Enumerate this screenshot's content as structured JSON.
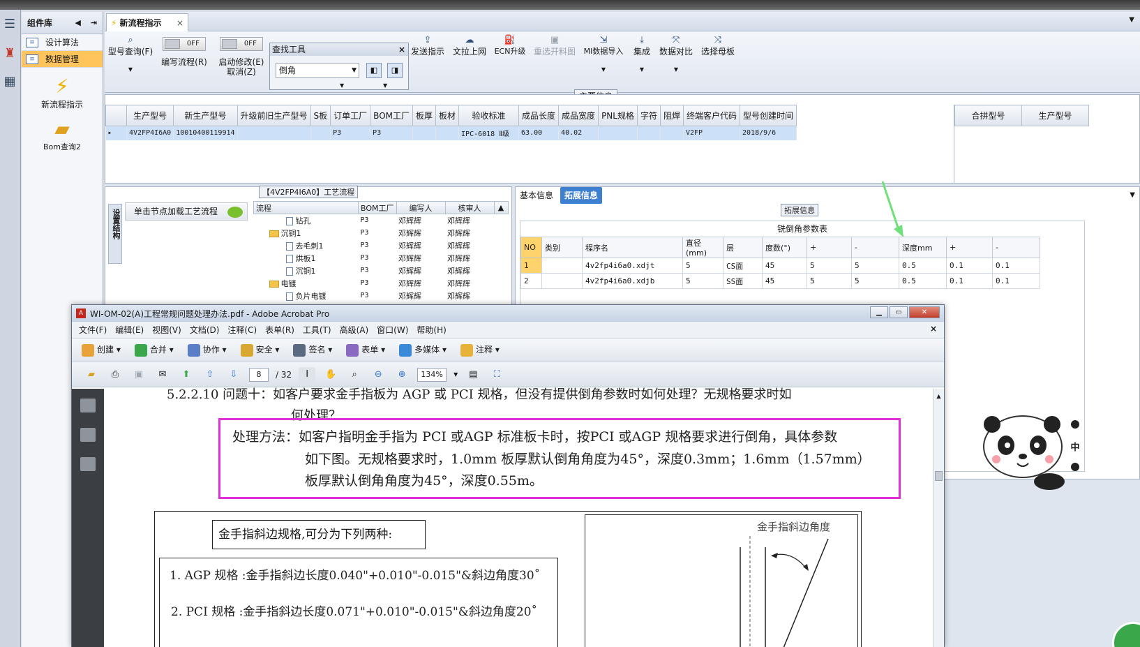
{
  "left_sidebar": {
    "header": "组件库",
    "items": [
      {
        "label": "设计算法",
        "active": false
      },
      {
        "label": "数据管理",
        "active": true
      }
    ],
    "big_items": [
      {
        "label": "新流程指示",
        "icon": "lightning-icon"
      },
      {
        "label": "Bom查询2",
        "icon": "folder-open-icon"
      }
    ]
  },
  "tab": {
    "title": "新流程指示",
    "close": "×"
  },
  "ribbon": {
    "query_label": "型号查询(F)",
    "edit_flow_label": "编写流程(R)",
    "auto_edit_label": "启动修改(E)",
    "cancel_label": "取消(Z)",
    "toggle_off": "OFF",
    "find_tool": {
      "title": "查找工具",
      "value": "倒角",
      "close": "×"
    },
    "buttons": [
      {
        "label": "发送指示",
        "icon": "upload-icon"
      },
      {
        "label": "文拉上网",
        "icon": "cloud-upload-icon"
      },
      {
        "label": "ECN升级",
        "icon": "ecn-icon"
      },
      {
        "label": "重选开料图",
        "icon": "image-icon",
        "disabled": true
      },
      {
        "label": "MI数据导入",
        "icon": "import-icon"
      },
      {
        "label": "集成",
        "icon": "download-icon"
      },
      {
        "label": "数据对比",
        "icon": "compare-icon"
      },
      {
        "label": "选择母板",
        "icon": "shuffle-icon"
      }
    ]
  },
  "main_info": {
    "title": "主要信息",
    "columns": [
      "生产型号",
      "新生产型号",
      "升级前旧生产型号",
      "S板",
      "订单工厂",
      "BOM工厂",
      "板厚",
      "板材",
      "验收标准",
      "成品长度",
      "成品宽度",
      "PNL规格",
      "字符",
      "阻焊",
      "终端客户代码",
      "型号创建时间"
    ],
    "row": [
      "4V2FP4I6A0",
      "10010400119914",
      "",
      "",
      "P3",
      "P3",
      "",
      "",
      "IPC-6018 Ⅱ级",
      "63.00",
      "40.02",
      "",
      "",
      "",
      "V2FP",
      "2018/9/6"
    ],
    "side_columns": [
      "合拼型号",
      "生产型号"
    ]
  },
  "process": {
    "title": "【4V2FP4I6A0】工艺流程",
    "vertical_tab": "设置结构",
    "hint": "单击节点加载工艺流程",
    "columns": [
      "流程",
      "BOM工厂",
      "编写人",
      "核审人"
    ],
    "rows": [
      {
        "name": "钻孔",
        "type": "doc",
        "indent": 2,
        "bom": "P3",
        "writer": "邓辉辉",
        "reviewer": "邓辉辉"
      },
      {
        "name": "沉铜1",
        "type": "folder",
        "indent": 1,
        "bom": "P3",
        "writer": "邓辉辉",
        "reviewer": "邓辉辉"
      },
      {
        "name": "去毛刺1",
        "type": "doc",
        "indent": 2,
        "bom": "P3",
        "writer": "邓辉辉",
        "reviewer": "邓辉辉"
      },
      {
        "name": "烘板1",
        "type": "doc",
        "indent": 2,
        "bom": "P3",
        "writer": "邓辉辉",
        "reviewer": "邓辉辉"
      },
      {
        "name": "沉铜1",
        "type": "doc",
        "indent": 2,
        "bom": "P3",
        "writer": "邓辉辉",
        "reviewer": "邓辉辉"
      },
      {
        "name": "电镀",
        "type": "folder",
        "indent": 1,
        "bom": "P3",
        "writer": "邓辉辉",
        "reviewer": "邓辉辉"
      },
      {
        "name": "负片电镀",
        "type": "doc",
        "indent": 2,
        "bom": "P3",
        "writer": "邓辉辉",
        "reviewer": "邓辉辉"
      }
    ]
  },
  "ext_info": {
    "tabs": [
      {
        "label": "基本信息",
        "active": false
      },
      {
        "label": "拓展信息",
        "active": true
      }
    ],
    "title": "拓展信息",
    "table_title": "铣倒角参数表",
    "columns": [
      "NO",
      "类别",
      "程序名",
      "直径(mm)",
      "层",
      "度数(°)",
      "+",
      "-",
      "深度mm",
      "+",
      "-"
    ],
    "rows": [
      [
        "1",
        "",
        "4v2fp4i6a0.xdjt",
        "5",
        "CS面",
        "45",
        "5",
        "5",
        "0.5",
        "0.1",
        "0.1"
      ],
      [
        "2",
        "",
        "4v2fp4i6a0.xdjb",
        "5",
        "SS面",
        "45",
        "5",
        "5",
        "0.5",
        "0.1",
        "0.1"
      ]
    ]
  },
  "acrobat": {
    "title": "WI-OM-02(A)工程常规问题处理办法.pdf - Adobe Acrobat Pro",
    "menus": [
      "文件(F)",
      "编辑(E)",
      "视图(V)",
      "文档(D)",
      "注释(C)",
      "表单(R)",
      "工具(T)",
      "高级(A)",
      "窗口(W)",
      "帮助(H)"
    ],
    "toolbar1": [
      {
        "label": "创建",
        "icon": "gear-icon",
        "color": "#e8a23a"
      },
      {
        "label": "合并",
        "icon": "merge-icon",
        "color": "#3aa84a"
      },
      {
        "label": "协作",
        "icon": "collaborate-icon",
        "color": "#5a7ec8"
      },
      {
        "label": "安全",
        "icon": "lock-icon",
        "color": "#d8a832"
      },
      {
        "label": "签名",
        "icon": "pen-icon",
        "color": "#5a6a80"
      },
      {
        "label": "表单",
        "icon": "form-icon",
        "color": "#8a6ac0"
      },
      {
        "label": "多媒体",
        "icon": "media-icon",
        "color": "#3a8ad8"
      },
      {
        "label": "注释",
        "icon": "comment-icon",
        "color": "#e8b23a"
      }
    ],
    "page_current": "8",
    "page_total": "/ 32",
    "zoom": "134%",
    "doc": {
      "line1": "5.2.2.10 问题十：如客户要求金手指板为 AGP 或 PCI 规格，但没有提供倒角参数时如何处理？无规格要求时如",
      "line2": "何处理？",
      "method1": "处理方法：如客户指明金手指为 PCI 或AGP 标准板卡时，按PCI 或AGP 规格要求进行倒角，具体参数",
      "method2": "如下图。无规格要求时，1.0mm 板厚默认倒角角度为45°，深度0.3mm；1.6mm（1.57mm）",
      "method3": "板厚默认倒角角度为45°，深度0.55m。",
      "fig_box_title": "金手指斜边规格,可分为下列两种:",
      "spec1": "1. AGP 规格 :金手指斜边长度0.040\"+0.010\"-0.015\"&斜边角度30˚",
      "spec2": "2.  PCI 规格 :金手指斜边长度0.071\"+0.010\"-0.015\"&斜边角度20˚",
      "diagram_label": "金手指斜边角度"
    }
  },
  "sticker": {
    "chars": [
      "中"
    ]
  }
}
